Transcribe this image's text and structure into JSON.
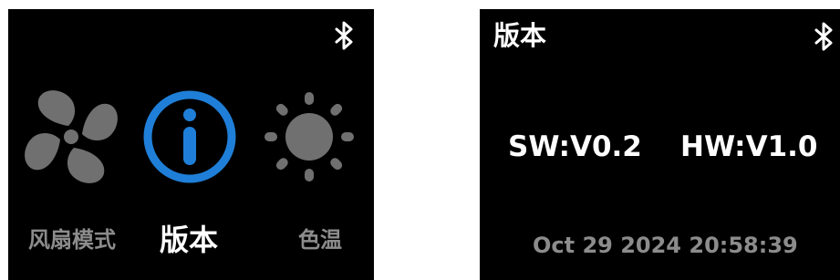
{
  "menu_screen": {
    "items": [
      {
        "label": "风扇模式",
        "icon": "fan-icon",
        "active": false
      },
      {
        "label": "版本",
        "icon": "info-icon",
        "active": true
      },
      {
        "label": "色温",
        "icon": "sun-icon",
        "active": false
      }
    ],
    "status_icon": "bluetooth-icon"
  },
  "version_screen": {
    "title": "版本",
    "sw_version": "SW:V0.2",
    "hw_version": "HW:V1.0",
    "build_date": "Oct 29 2024 20:58:39",
    "status_icon": "bluetooth-icon"
  },
  "colors": {
    "background": "#000000",
    "active_accent": "#1f7fd8",
    "inactive_icon": "#707070",
    "inactive_text": "#8c8c8c",
    "active_text": "#ffffff"
  }
}
